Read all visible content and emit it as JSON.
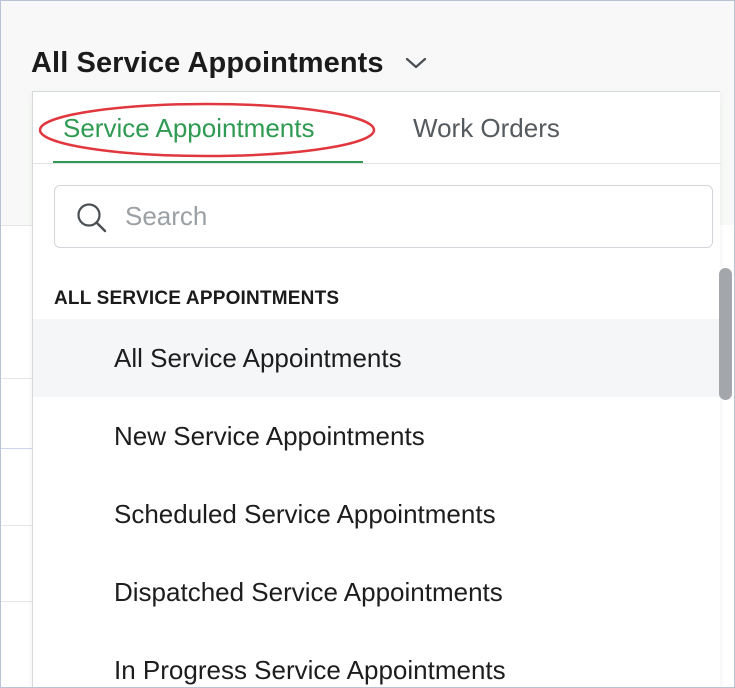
{
  "header": {
    "view_title": "All Service Appointments",
    "view_chevron_icon": "chevron-down-icon"
  },
  "dropdown": {
    "tabs": [
      {
        "label": "Service Appointments",
        "active": true
      },
      {
        "label": "Work Orders",
        "active": false
      }
    ],
    "search": {
      "placeholder": "Search",
      "value": "",
      "icon": "search-icon"
    },
    "section_heading": "ALL SERVICE APPOINTMENTS",
    "items": [
      {
        "label": "All Service Appointments",
        "active": true
      },
      {
        "label": "New Service Appointments",
        "active": false
      },
      {
        "label": "Scheduled Service Appointments",
        "active": false
      },
      {
        "label": "Dispatched Service Appointments",
        "active": false
      },
      {
        "label": "In Progress Service Appointments",
        "active": false
      }
    ]
  },
  "colors": {
    "accent_green": "#2f9a52",
    "highlight_ellipse": "#e0383e",
    "inactive_tab": "#555a5e",
    "scrollbar": "#a3a7ac"
  }
}
